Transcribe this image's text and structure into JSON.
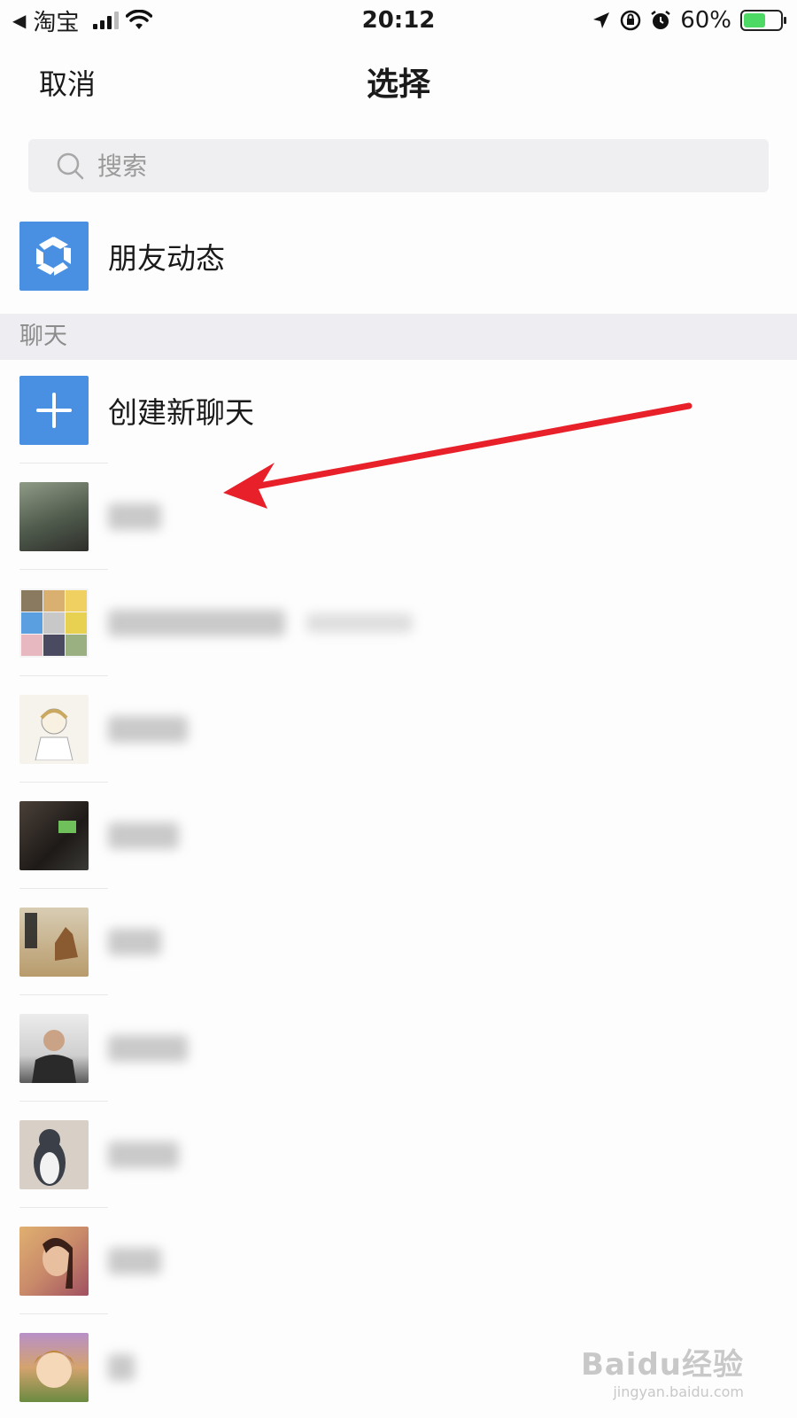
{
  "status_bar": {
    "back_app": "淘宝",
    "time": "20:12",
    "battery": "60%",
    "battery_level": 0.6
  },
  "nav": {
    "cancel": "取消",
    "title": "选择"
  },
  "search": {
    "placeholder": "搜索"
  },
  "moments": {
    "label": "朋友动态"
  },
  "section": {
    "chats_header": "聊天"
  },
  "create_chat": {
    "label": "创建新聊天"
  },
  "contacts": [
    {
      "avatar": "photo-avatar",
      "color": "#5d6a5c"
    },
    {
      "avatar": "group-avatar",
      "color": "#d9c48a"
    },
    {
      "avatar": "anime-sketch-avatar",
      "color": "#f2efe8"
    },
    {
      "avatar": "photo-avatar",
      "color": "#2b2623"
    },
    {
      "avatar": "fox-poster-avatar",
      "color": "#b89b6c"
    },
    {
      "avatar": "person-photo-avatar",
      "color": "#7d7c7a"
    },
    {
      "avatar": "penguin-avatar",
      "color": "#c9bfb5"
    },
    {
      "avatar": "selfie-avatar",
      "color": "#c98a6a"
    },
    {
      "avatar": "anime-avatar",
      "color": "#d4a36e"
    }
  ],
  "watermark": {
    "main": "Baidu经验",
    "sub": "jingyan.baidu.com"
  },
  "colors": {
    "accent_blue": "#4a90e2",
    "arrow_red": "#e8202a",
    "section_bg": "#eeeef2"
  }
}
